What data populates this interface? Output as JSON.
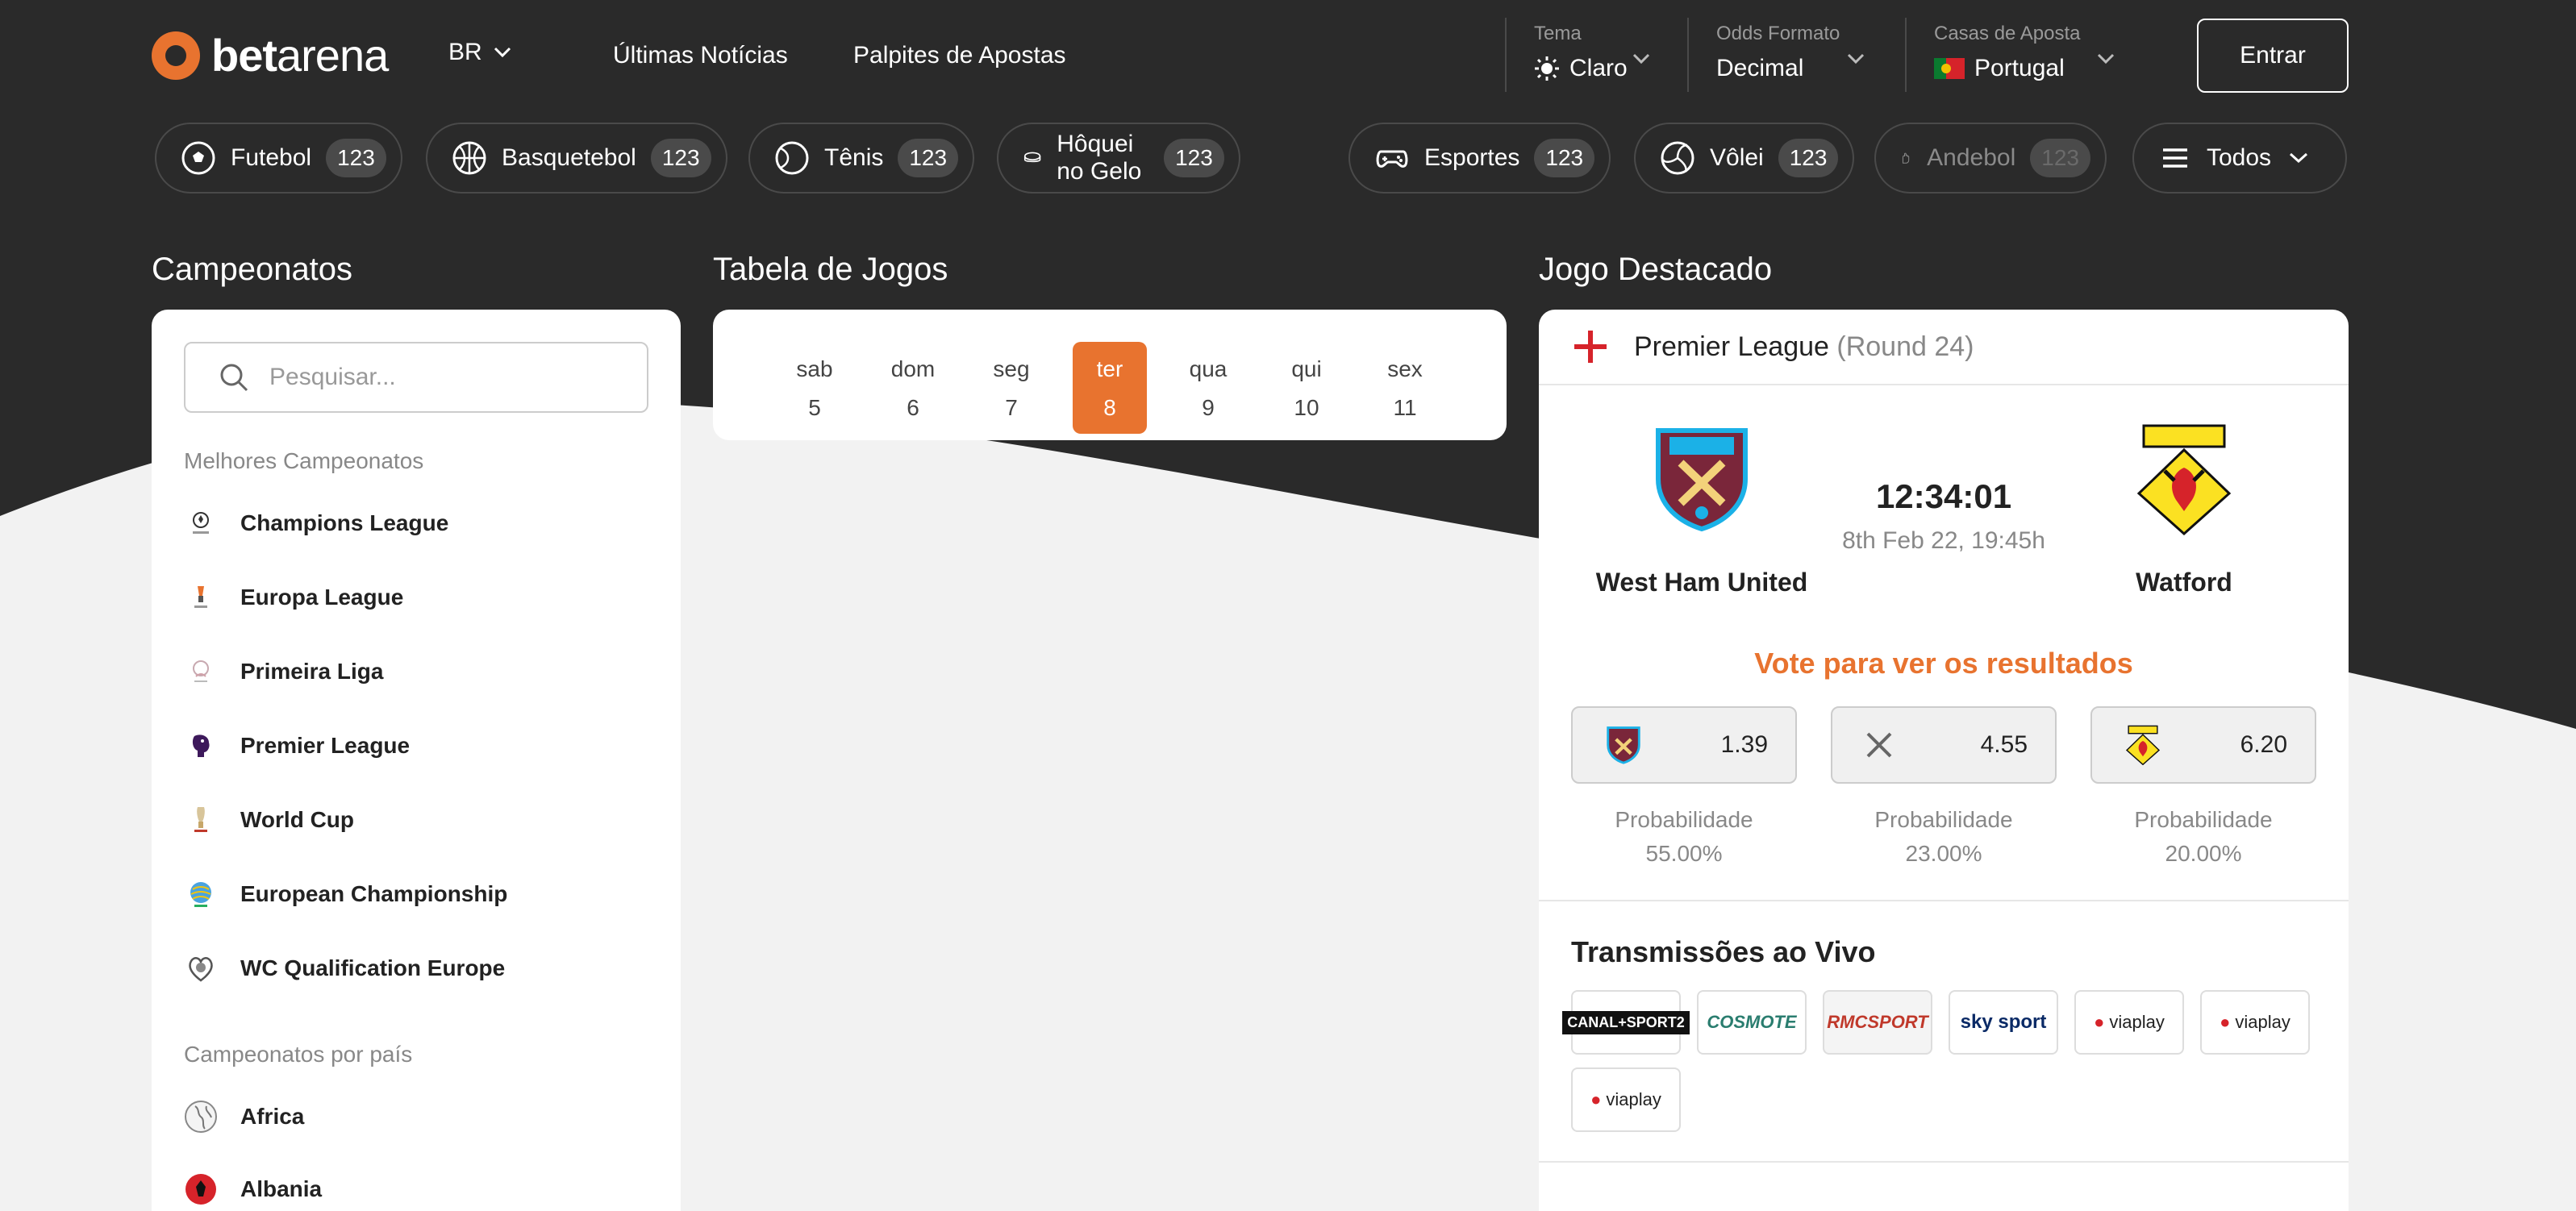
{
  "brand": {
    "name_bold": "bet",
    "name_light": "arena",
    "accent": "#e8732f",
    "dark": "#2a2a2a"
  },
  "header": {
    "lang": "BR",
    "nav": [
      "Últimas Notícias",
      "Palpites de Apostas"
    ],
    "theme": {
      "label": "Tema",
      "value": "Claro"
    },
    "odds": {
      "label": "Odds Formato",
      "value": "Decimal"
    },
    "bookmaker": {
      "label": "Casas de Aposta",
      "value": "Portugal"
    },
    "login": "Entrar"
  },
  "sports": [
    {
      "label": "Futebol",
      "count": "123",
      "icon": "soccer-ball-icon"
    },
    {
      "label": "Basquetebol",
      "count": "123",
      "icon": "basketball-icon"
    },
    {
      "label": "Tênis",
      "count": "123",
      "icon": "tennis-ball-icon"
    },
    {
      "label": "Hôquei no Gelo",
      "count": "123",
      "icon": "hockey-puck-icon"
    },
    {
      "label": "Esportes",
      "count": "123",
      "icon": "gamepad-icon"
    },
    {
      "label": "Vôlei",
      "count": "123",
      "icon": "volleyball-icon"
    },
    {
      "label": "Andebol",
      "count": "123",
      "icon": "handball-icon"
    }
  ],
  "sports_all": "Todos",
  "sections": {
    "leagues": "Campeonatos",
    "games": "Tabela de Jogos",
    "featured": "Jogo Destacado"
  },
  "leagues_panel": {
    "search_placeholder": "Pesquisar...",
    "top_title": "Melhores Campeonatos",
    "top": [
      "Champions League",
      "Europa League",
      "Primeira Liga",
      "Premier League",
      "World Cup",
      "European Championship",
      "WC Qualification Europe"
    ],
    "country_title": "Campeonatos por país",
    "countries": [
      "Africa",
      "Albania"
    ]
  },
  "days": [
    {
      "name": "sab",
      "num": "5"
    },
    {
      "name": "dom",
      "num": "6"
    },
    {
      "name": "seg",
      "num": "7"
    },
    {
      "name": "ter",
      "num": "8",
      "selected": true
    },
    {
      "name": "qua",
      "num": "9"
    },
    {
      "name": "qui",
      "num": "10"
    },
    {
      "name": "sex",
      "num": "11"
    }
  ],
  "featured": {
    "league": "Premier League",
    "round": "(Round 24)",
    "home": "West Ham United",
    "away": "Watford",
    "time": "12:34:01",
    "date": "8th Feb 22, 19:45h",
    "vote_text": "Vote para ver os resultados",
    "odds": [
      {
        "value": "1.39",
        "prob_label": "Probabilidade",
        "prob": "55.00%"
      },
      {
        "value": "4.55",
        "prob_label": "Probabilidade",
        "prob": "23.00%"
      },
      {
        "value": "6.20",
        "prob_label": "Probabilidade",
        "prob": "20.00%"
      }
    ],
    "tv_title": "Transmissões ao Vivo",
    "tv": [
      "CANAL+SPORT2",
      "COSMOTE",
      "RMCSPORT",
      "sky sport",
      "viaplay",
      "viaplay",
      "viaplay"
    ]
  }
}
